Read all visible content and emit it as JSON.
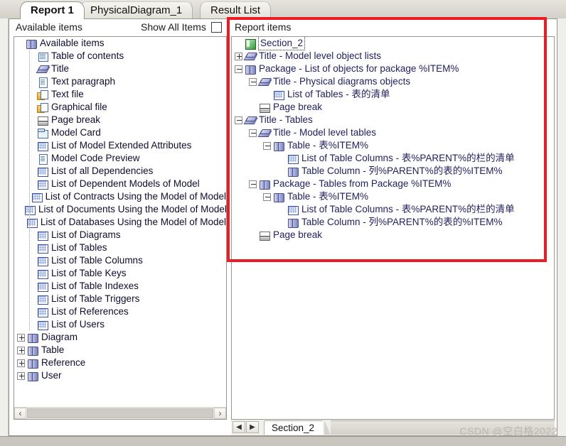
{
  "tabs": [
    {
      "label": "Report 1",
      "active": true
    },
    {
      "label": "PhysicalDiagram_1",
      "active": false
    },
    {
      "label": "Result List",
      "active": false
    }
  ],
  "panels": {
    "left_header": "Available items",
    "show_all_label": "Show All Items",
    "right_header": "Report items"
  },
  "available_items": {
    "root": "Available items",
    "items": [
      {
        "label": "Table of contents",
        "icon": "toc-icon",
        "depth": 1,
        "expander": "none"
      },
      {
        "label": "Title",
        "icon": "title-icon",
        "depth": 1,
        "expander": "none"
      },
      {
        "label": "Text paragraph",
        "icon": "document-icon",
        "depth": 1,
        "expander": "none"
      },
      {
        "label": "Text file",
        "icon": "text-file-icon",
        "depth": 1,
        "expander": "none"
      },
      {
        "label": "Graphical file",
        "icon": "graphical-file-icon",
        "depth": 1,
        "expander": "none"
      },
      {
        "label": "Page break",
        "icon": "page-break-icon",
        "depth": 1,
        "expander": "none"
      },
      {
        "label": "Model Card",
        "icon": "model-card-icon",
        "depth": 1,
        "expander": "none"
      },
      {
        "label": "List of Model Extended Attributes",
        "icon": "grid-icon",
        "depth": 1,
        "expander": "none"
      },
      {
        "label": "Model Code Preview",
        "icon": "document-icon",
        "depth": 1,
        "expander": "none"
      },
      {
        "label": "List of all Dependencies",
        "icon": "grid-icon",
        "depth": 1,
        "expander": "none"
      },
      {
        "label": "List of Dependent Models of Model",
        "icon": "grid-icon",
        "depth": 1,
        "expander": "none"
      },
      {
        "label": "List of Contracts Using the Model of Model",
        "icon": "grid-icon",
        "depth": 1,
        "expander": "none"
      },
      {
        "label": "List of Documents Using the Model of Model",
        "icon": "grid-icon",
        "depth": 1,
        "expander": "none"
      },
      {
        "label": "List of Databases Using the Model of Model",
        "icon": "grid-icon",
        "depth": 1,
        "expander": "none"
      },
      {
        "label": "List of Diagrams",
        "icon": "grid-icon",
        "depth": 1,
        "expander": "none"
      },
      {
        "label": "List of Tables",
        "icon": "grid-icon",
        "depth": 1,
        "expander": "none"
      },
      {
        "label": "List of Table Columns",
        "icon": "grid-icon",
        "depth": 1,
        "expander": "none"
      },
      {
        "label": "List of Table Keys",
        "icon": "grid-icon",
        "depth": 1,
        "expander": "none"
      },
      {
        "label": "List of Table Indexes",
        "icon": "grid-icon",
        "depth": 1,
        "expander": "none"
      },
      {
        "label": "List of Table Triggers",
        "icon": "grid-icon",
        "depth": 1,
        "expander": "none"
      },
      {
        "label": "List of References",
        "icon": "grid-icon",
        "depth": 1,
        "expander": "none"
      },
      {
        "label": "List of Users",
        "icon": "grid-icon",
        "depth": 1,
        "expander": "none"
      },
      {
        "label": "Diagram",
        "icon": "books-icon",
        "depth": 0,
        "expander": "plus"
      },
      {
        "label": "Table",
        "icon": "books-icon",
        "depth": 0,
        "expander": "plus"
      },
      {
        "label": "Reference",
        "icon": "books-icon",
        "depth": 0,
        "expander": "plus"
      },
      {
        "label": "User",
        "icon": "books-icon",
        "depth": 0,
        "expander": "plus"
      }
    ]
  },
  "report_items": {
    "items": [
      {
        "label": "Section_2",
        "icon": "section-icon",
        "depth": 0,
        "expander": "none",
        "selected": true
      },
      {
        "label": "Title - Model level object lists",
        "icon": "title-icon",
        "depth": 0,
        "expander": "plus"
      },
      {
        "label": "Package - List of objects for package %ITEM%",
        "icon": "books-icon",
        "depth": 0,
        "expander": "minus"
      },
      {
        "label": "Title - Physical diagrams objects",
        "icon": "title-icon",
        "depth": 1,
        "expander": "minus"
      },
      {
        "label": "List of Tables - 表的清单",
        "icon": "grid-icon",
        "depth": 2,
        "expander": "none"
      },
      {
        "label": "Page break",
        "icon": "page-break-icon",
        "depth": 1,
        "expander": "none"
      },
      {
        "label": "Title - Tables",
        "icon": "title-icon",
        "depth": 0,
        "expander": "minus"
      },
      {
        "label": "Title - Model level tables",
        "icon": "title-icon",
        "depth": 1,
        "expander": "minus"
      },
      {
        "label": "Table - 表%ITEM%",
        "icon": "books-icon",
        "depth": 2,
        "expander": "minus"
      },
      {
        "label": "List of Table Columns - 表%PARENT%的栏的清单",
        "icon": "grid-icon",
        "depth": 3,
        "expander": "none"
      },
      {
        "label": "Table Column - 列%PARENT%的表的%ITEM%",
        "icon": "books-icon",
        "depth": 3,
        "expander": "none"
      },
      {
        "label": "Package - Tables from Package %ITEM%",
        "icon": "books-icon",
        "depth": 1,
        "expander": "minus"
      },
      {
        "label": "Table - 表%ITEM%",
        "icon": "books-icon",
        "depth": 2,
        "expander": "minus"
      },
      {
        "label": "List of Table Columns - 表%PARENT%的栏的清单",
        "icon": "grid-icon",
        "depth": 3,
        "expander": "none"
      },
      {
        "label": "Table Column - 列%PARENT%的表的%ITEM%",
        "icon": "books-icon",
        "depth": 3,
        "expander": "none"
      },
      {
        "label": "Page break",
        "icon": "page-break-icon",
        "depth": 1,
        "expander": "none"
      }
    ]
  },
  "bottom": {
    "prev_icon": "◀",
    "next_icon": "▶",
    "section_tab": "Section_2"
  },
  "left_scrollbar": {
    "left_icon": "‹",
    "right_icon": "›"
  },
  "annotation": {
    "highlight_color": "#ec1c24"
  },
  "watermark": "CSDN @空白格2022"
}
